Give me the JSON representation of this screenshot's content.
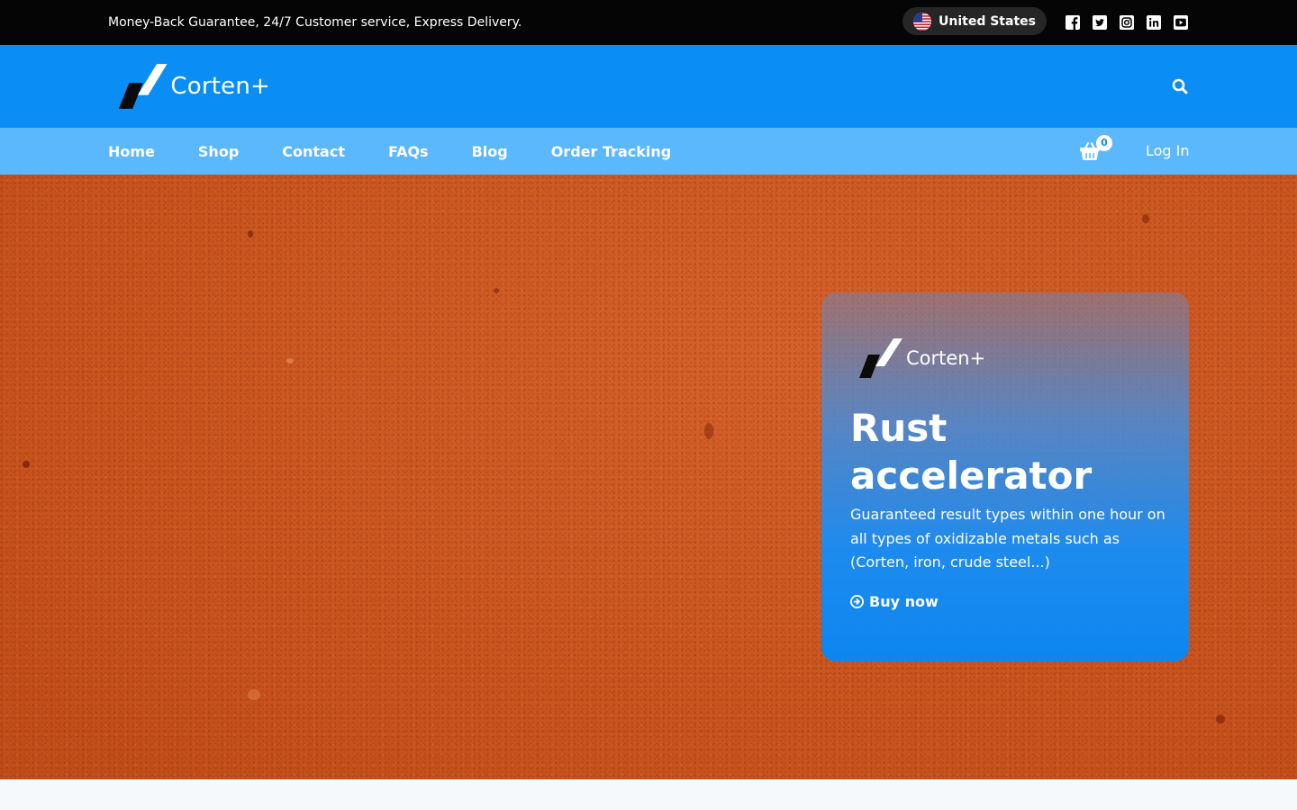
{
  "topbar": {
    "message": "Money-Back Guarantee, 24/7 Customer service, Express Delivery.",
    "country": "United States",
    "socials": [
      "facebook-icon",
      "twitter-icon",
      "instagram-icon",
      "linkedin-icon",
      "youtube-icon"
    ]
  },
  "header": {
    "logo_text": "Corten+"
  },
  "nav": {
    "items": [
      "Home",
      "Shop",
      "Contact",
      "FAQs",
      "Blog",
      "Order Tracking"
    ],
    "cart_count": "0",
    "login": "Log In"
  },
  "hero": {
    "card_logo_text": "Corten+",
    "title": "Rust accelerator",
    "description": "Guaranteed result types within one hour on all types of oxidizable metals such as (Corten, iron, crude steel...)",
    "cta": "Buy now"
  },
  "colors": {
    "topbar": "#050505",
    "header": "#0a8ef5",
    "nav": "#5cb8fc",
    "hero": "#cf5a22"
  }
}
